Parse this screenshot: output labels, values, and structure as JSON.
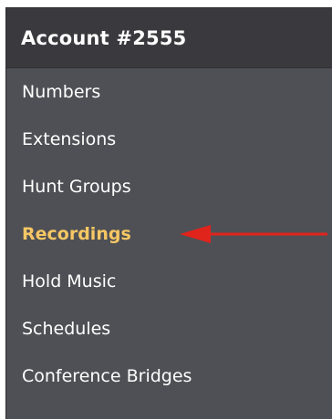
{
  "header": {
    "title": "Account #2555"
  },
  "menu": {
    "items": [
      {
        "label": "Numbers"
      },
      {
        "label": "Extensions"
      },
      {
        "label": "Hunt Groups"
      },
      {
        "label": "Recordings"
      },
      {
        "label": "Hold Music"
      },
      {
        "label": "Schedules"
      },
      {
        "label": "Conference Bridges"
      }
    ],
    "active_item": "Recordings"
  },
  "colors": {
    "panel_background": "#4f5055",
    "header_background": "#3a3a3e",
    "text": "#ffffff",
    "active_text": "#f6c764",
    "annotation_arrow": "#e0241c"
  },
  "annotation": {
    "icon": "left-arrow-icon",
    "points_to": "Recordings"
  }
}
